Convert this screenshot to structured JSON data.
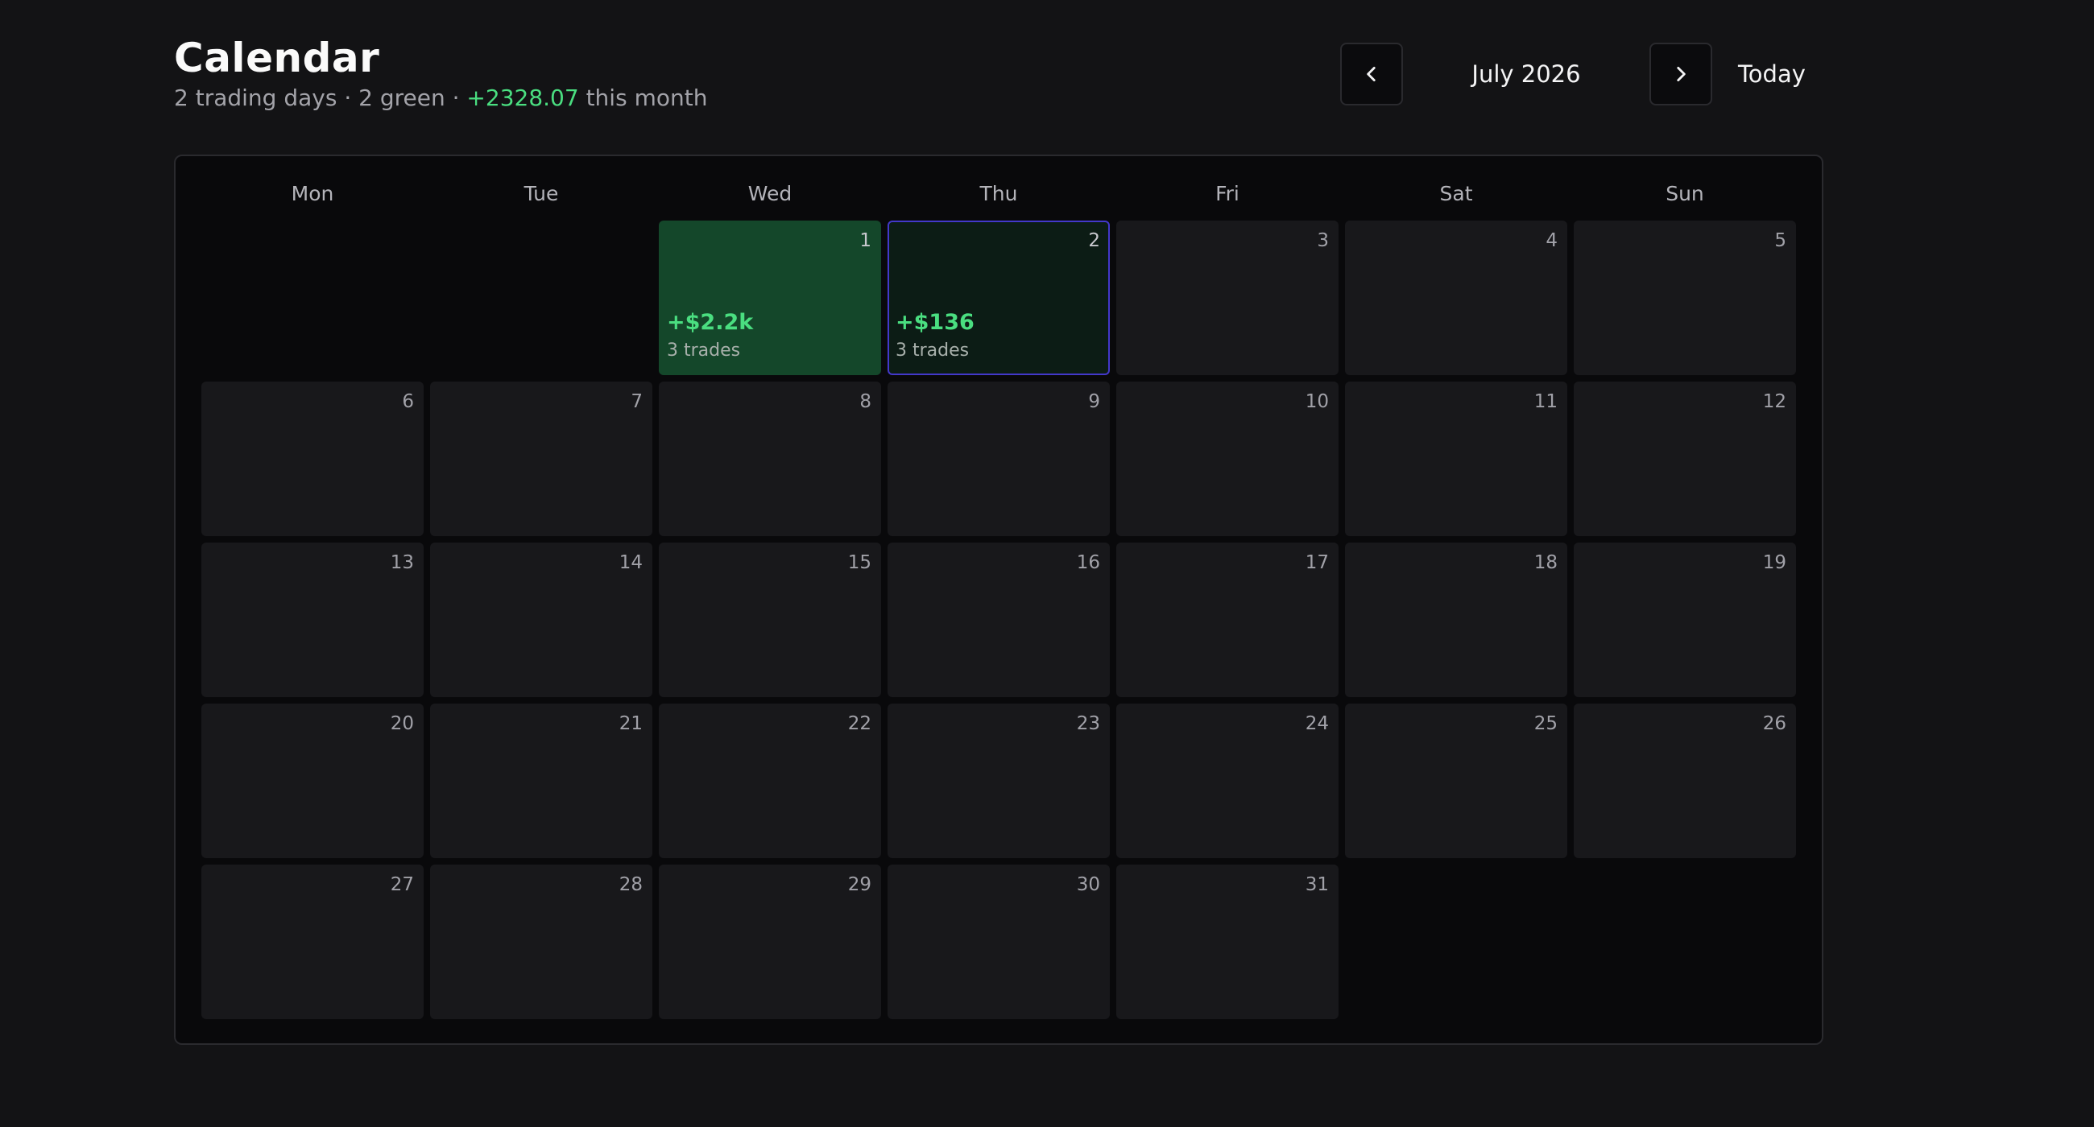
{
  "header": {
    "title": "Calendar",
    "summary_prefix": "2 trading days · 2 green · ",
    "summary_pnl": "+2328.07",
    "summary_suffix": " this month"
  },
  "nav": {
    "prev_icon": "chevron-left-icon",
    "next_icon": "chevron-right-icon",
    "month_label": "July 2026",
    "today_label": "Today"
  },
  "weekdays": [
    "Mon",
    "Tue",
    "Wed",
    "Thu",
    "Fri",
    "Sat",
    "Sun"
  ],
  "leading_blank_days": 2,
  "trailing_blank_days": 2,
  "days": [
    {
      "day": "1",
      "pnl": "+$2.2k",
      "trades": "3 trades",
      "state": "win-strong"
    },
    {
      "day": "2",
      "pnl": "+$136",
      "trades": "3 trades",
      "state": "win-light"
    },
    {
      "day": "3"
    },
    {
      "day": "4"
    },
    {
      "day": "5"
    },
    {
      "day": "6"
    },
    {
      "day": "7"
    },
    {
      "day": "8"
    },
    {
      "day": "9"
    },
    {
      "day": "10"
    },
    {
      "day": "11"
    },
    {
      "day": "12"
    },
    {
      "day": "13"
    },
    {
      "day": "14"
    },
    {
      "day": "15"
    },
    {
      "day": "16"
    },
    {
      "day": "17"
    },
    {
      "day": "18"
    },
    {
      "day": "19"
    },
    {
      "day": "20"
    },
    {
      "day": "21"
    },
    {
      "day": "22"
    },
    {
      "day": "23"
    },
    {
      "day": "24"
    },
    {
      "day": "25"
    },
    {
      "day": "26"
    },
    {
      "day": "27"
    },
    {
      "day": "28"
    },
    {
      "day": "29"
    },
    {
      "day": "30"
    },
    {
      "day": "31"
    }
  ],
  "colors": {
    "background": "#131315",
    "panel": "#09090b",
    "cell": "#18181b",
    "positive": "#4ade80",
    "win_strong_cell": "#14472a",
    "win_light_cell": "#0c1c15",
    "selected_border": "#4338ca"
  }
}
